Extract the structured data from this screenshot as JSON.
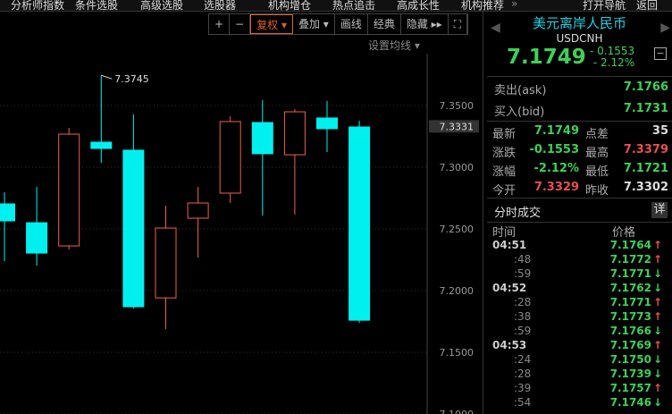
{
  "menu": [
    "分析师指数",
    "条件选股",
    "高级选股",
    "选股器",
    "机构增仓",
    "热点追击",
    "高成长性",
    "机构推荐",
    "»",
    "打开导航",
    "返回"
  ],
  "toolbar": {
    "plus": "+",
    "minus": "−",
    "fuquan": "复权 ▾",
    "overlay": "叠加 ▾",
    "draw": "画线",
    "classic": "经典",
    "hide": "隐藏 ▸▸",
    "fullscreen": "⛶"
  },
  "ma_setting": "设置均线 ▾",
  "chart_data": {
    "type": "candlestick",
    "ylim": [
      7.1,
      7.375
    ],
    "yticks": [
      "7.3500",
      "7.3000",
      "7.2500",
      "7.2000",
      "7.1500",
      "7.1000"
    ],
    "current_price_label": "7.3331",
    "high_annotation": "7.3745",
    "candles": [
      {
        "o": 7.2703,
        "h": 7.2797,
        "l": 7.2239,
        "c": 7.2565
      },
      {
        "o": 7.255,
        "h": 7.284,
        "l": 7.2202,
        "c": 7.2304
      },
      {
        "o": 7.2362,
        "h": 7.3319,
        "l": 7.2333,
        "c": 7.3268
      },
      {
        "o": 7.3203,
        "h": 7.3745,
        "l": 7.3036,
        "c": 7.3152
      },
      {
        "o": 7.3138,
        "h": 7.3428,
        "l": 7.1854,
        "c": 7.1869
      },
      {
        "o": 7.1941,
        "h": 7.2688,
        "l": 7.1688,
        "c": 7.2507
      },
      {
        "o": 7.2587,
        "h": 7.284,
        "l": 7.2268,
        "c": 7.271
      },
      {
        "o": 7.279,
        "h": 7.3413,
        "l": 7.271,
        "c": 7.337
      },
      {
        "o": 7.3362,
        "h": 7.3544,
        "l": 7.2608,
        "c": 7.3109
      },
      {
        "o": 7.3101,
        "h": 7.3471,
        "l": 7.2616,
        "c": 7.3449
      },
      {
        "o": 7.3399,
        "h": 7.3536,
        "l": 7.3123,
        "c": 7.3312
      },
      {
        "o": 7.3326,
        "h": 7.3377,
        "l": 7.1738,
        "c": 7.176
      }
    ]
  },
  "quote": {
    "name": "美元离岸人民币",
    "code": "USDCNH",
    "last": "7.1749",
    "change": "- 0.1553",
    "pct": "- 2.12%",
    "ask_label": "卖出(ask)",
    "ask": "7.1766",
    "bid_label": "买入(bid)",
    "bid": "7.1731",
    "stats": [
      [
        "最新",
        "7.1749",
        "点差",
        "35"
      ],
      [
        "涨跌",
        "-0.1553",
        "最高",
        "7.3379"
      ],
      [
        "涨幅",
        "-2.12%",
        "最低",
        "7.1721"
      ],
      [
        "今开",
        "7.3329",
        "昨收",
        "7.3302"
      ]
    ]
  },
  "ticks": {
    "title": "分时成交",
    "detail": "详",
    "col_time": "时间",
    "col_price": "价格",
    "rows": [
      [
        "04:51",
        "7.1764",
        "up"
      ],
      [
        ":48",
        "7.1772",
        "up"
      ],
      [
        ":59",
        "7.1771",
        "down"
      ],
      [
        "04:52",
        "7.1762",
        "down"
      ],
      [
        ":28",
        "7.1771",
        "up"
      ],
      [
        ":38",
        "7.1773",
        "up"
      ],
      [
        ":59",
        "7.1766",
        "down"
      ],
      [
        "04:53",
        "7.1769",
        "up"
      ],
      [
        ":24",
        "7.1750",
        "down"
      ],
      [
        ":28",
        "7.1739",
        "down"
      ],
      [
        ":39",
        "7.1757",
        "up"
      ],
      [
        ":54",
        "7.1746",
        "down"
      ]
    ]
  }
}
